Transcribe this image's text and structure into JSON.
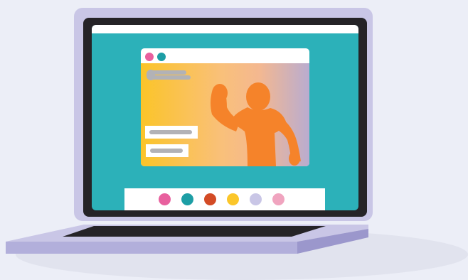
{
  "illustration": {
    "subject": "laptop-video-call",
    "colors": {
      "background": "#eceef7",
      "laptop_frame": "#c9c6e6",
      "bezel": "#252327",
      "screen": "#2cb1b9",
      "window_chrome": "#ffffff",
      "person": "#f5832a",
      "gradient_start": "#fbc429",
      "gradient_end": "#b9acd0",
      "placeholder_bar": "#b2b2b6"
    },
    "window_dots": [
      {
        "name": "pink-dot",
        "color": "#e8609e"
      },
      {
        "name": "teal-dot",
        "color": "#1d9ea5"
      }
    ],
    "control_dots": [
      {
        "name": "pink",
        "color": "#e8609e"
      },
      {
        "name": "teal",
        "color": "#1d9ea5"
      },
      {
        "name": "red",
        "color": "#d34b25"
      },
      {
        "name": "yellow",
        "color": "#fbc62a"
      },
      {
        "name": "lavender",
        "color": "#c9c6e6"
      },
      {
        "name": "light-pink",
        "color": "#f0a4bf"
      }
    ]
  }
}
